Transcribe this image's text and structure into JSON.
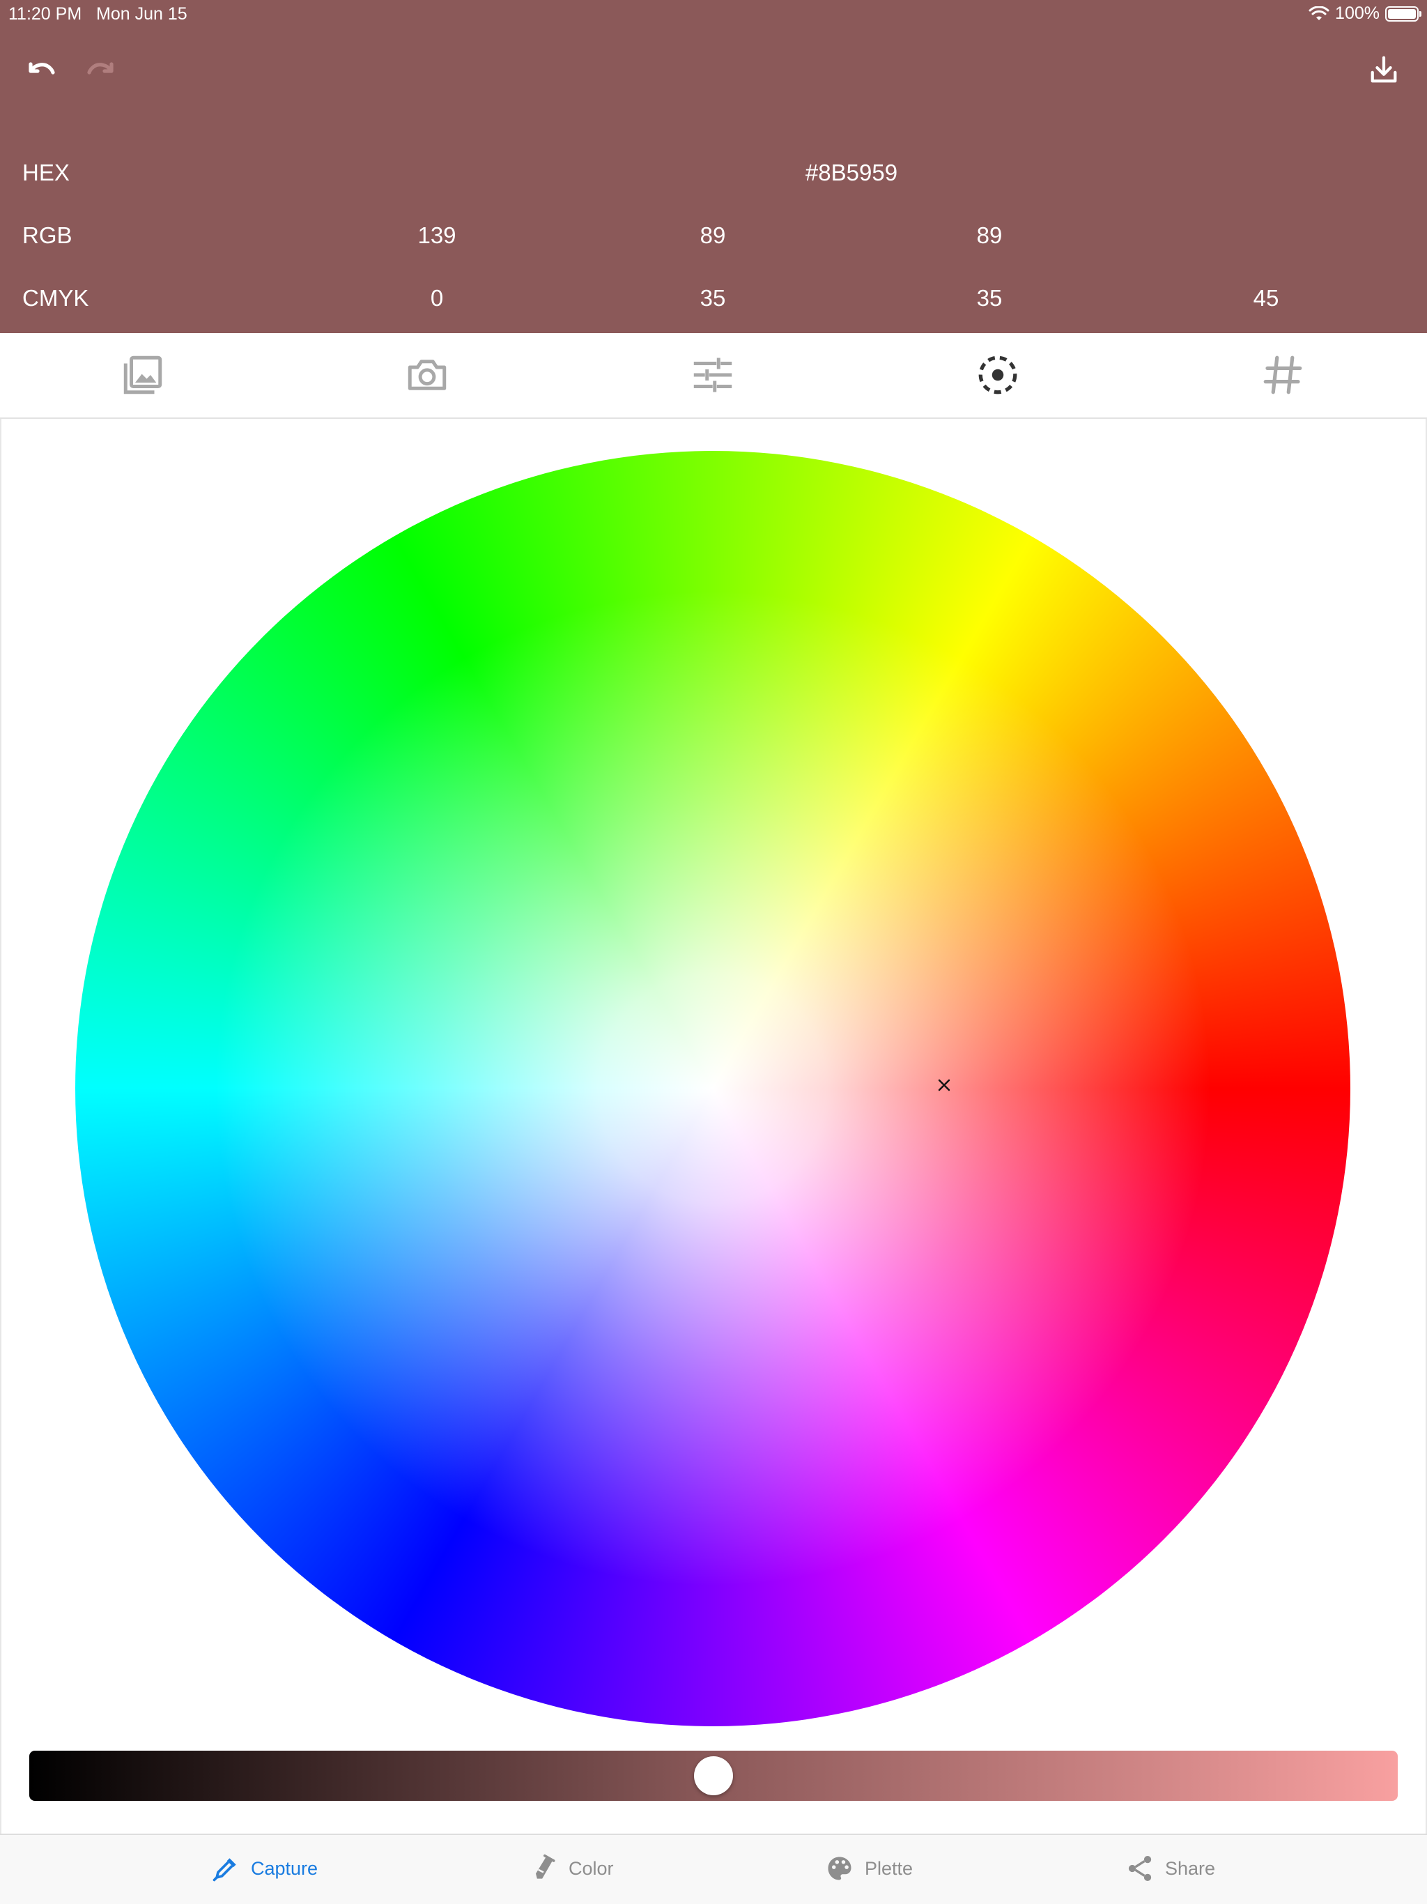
{
  "status_bar": {
    "time": "11:20 PM",
    "date": "Mon Jun 15",
    "battery": "100%"
  },
  "header": {
    "background": "#8B5959",
    "hex": {
      "label": "HEX",
      "value": "#8B5959"
    },
    "rgb": {
      "label": "RGB",
      "r": "139",
      "g": "89",
      "b": "89"
    },
    "cmyk": {
      "label": "CMYK",
      "c": "0",
      "m": "35",
      "y": "35",
      "k": "45"
    }
  },
  "toolbar_icons": [
    "undo-icon",
    "redo-icon",
    "download-icon"
  ],
  "mode_tabs": [
    "gallery-icon",
    "camera-icon",
    "sliders-icon",
    "color-wheel-icon",
    "hash-icon"
  ],
  "selected_mode": "color-wheel",
  "slider": {
    "value": 0.5
  },
  "bottom_tabs": [
    {
      "label": "Capture",
      "icon": "eyedropper-icon",
      "active": true
    },
    {
      "label": "Color",
      "icon": "paint-tube-icon",
      "active": false
    },
    {
      "label": "Plette",
      "icon": "palette-icon",
      "active": false
    },
    {
      "label": "Share",
      "icon": "share-icon",
      "active": false
    }
  ],
  "colors": {
    "active_tab": "#1a7ce0",
    "inactive_tab": "#8e8e8e"
  }
}
